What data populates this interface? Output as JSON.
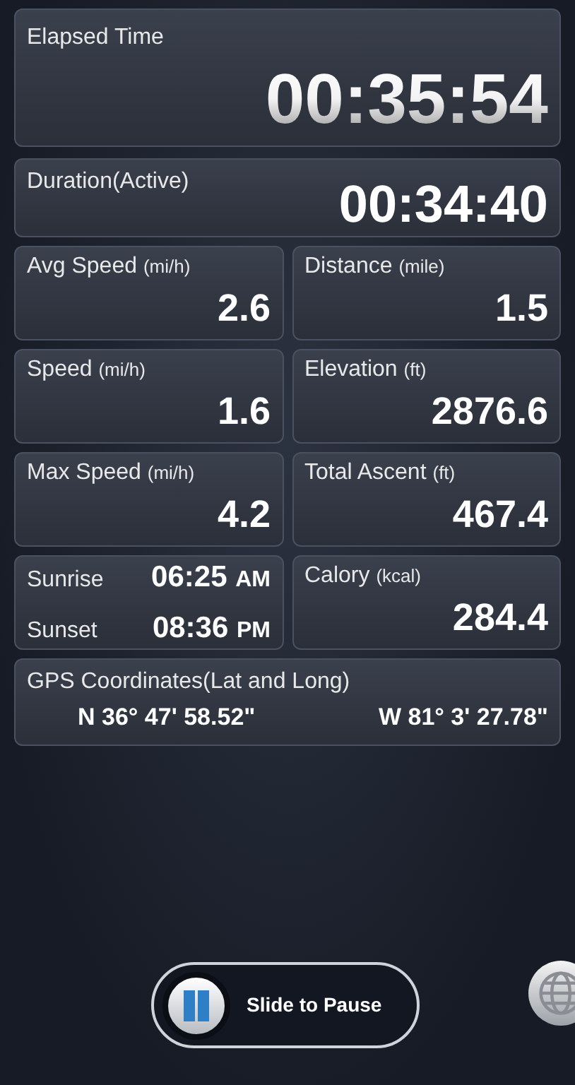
{
  "elapsed": {
    "label": "Elapsed Time",
    "value": "00:35:54"
  },
  "duration": {
    "label": "Duration(Active)",
    "value": "00:34:40"
  },
  "tiles": [
    {
      "kind": "metric",
      "label": "Avg Speed",
      "unit": "(mi/h)",
      "value": "2.6"
    },
    {
      "kind": "metric",
      "label": "Distance",
      "unit": "(mile)",
      "value": "1.5"
    },
    {
      "kind": "metric",
      "label": "Speed",
      "unit": "(mi/h)",
      "value": "1.6"
    },
    {
      "kind": "metric",
      "label": "Elevation",
      "unit": "(ft)",
      "value": "2876.6"
    },
    {
      "kind": "metric",
      "label": "Max Speed",
      "unit": "(mi/h)",
      "value": "4.2"
    },
    {
      "kind": "metric",
      "label": "Total Ascent",
      "unit": "(ft)",
      "value": "467.4"
    },
    {
      "kind": "sun",
      "rows": [
        {
          "label": "Sunrise",
          "time": "06:25",
          "period": "AM"
        },
        {
          "label": "Sunset",
          "time": "08:36",
          "period": "PM"
        }
      ]
    },
    {
      "kind": "metric",
      "label": "Calory",
      "unit": "(kcal)",
      "value": "284.4"
    }
  ],
  "gps": {
    "label": "GPS Coordinates(Lat and Long)",
    "lat": "N 36° 47' 58.52\"",
    "long": "W 81° 3' 27.78\""
  },
  "slider": {
    "label": "Slide to Pause"
  }
}
